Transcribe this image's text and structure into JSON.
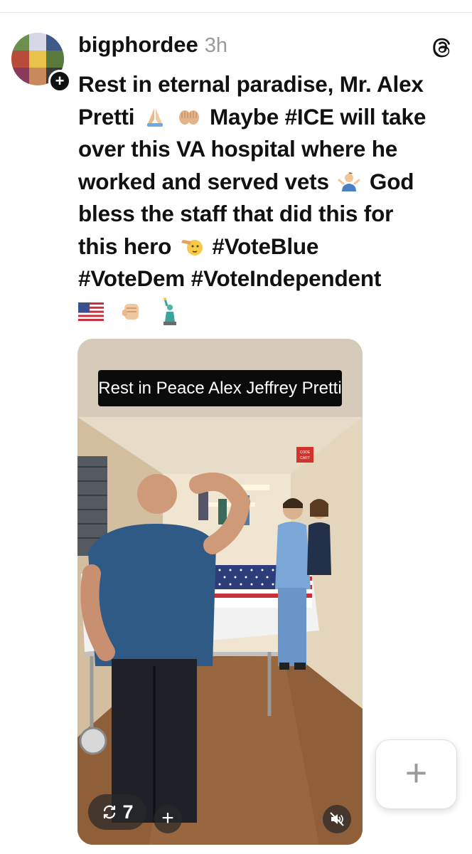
{
  "post": {
    "username": "bigphordee",
    "timestamp": "3h",
    "follow_symbol": "+",
    "text_lines": [
      "Rest in eternal paradise, Mr. Alex",
      "Pretti",
      "Maybe #ICE will take",
      "over this VA hospital where he",
      "worked and served vets",
      "God",
      "bless the staff that did this for",
      "this hero",
      "#VoteBlue",
      "#VoteDem #VoteIndependent"
    ],
    "icons": [
      "folded-hands-emoji",
      "palms-up-emoji",
      "person-shrugging-emoji",
      "saluting-emoji",
      "us-flag-emoji",
      "raised-fist-emoji",
      "statue-of-liberty-emoji",
      "threads-logo-icon"
    ]
  },
  "media": {
    "caption": "Rest in Peace Alex Jeffrey Pretti",
    "repost_count": "7",
    "add_symbol": "+",
    "sign_text_1": "CODE",
    "sign_text_2": "CART"
  },
  "fab": {
    "symbol": "+"
  },
  "colors": {
    "text": "#111111",
    "muted": "#9a9a9a",
    "divider": "#e2e2e2"
  }
}
